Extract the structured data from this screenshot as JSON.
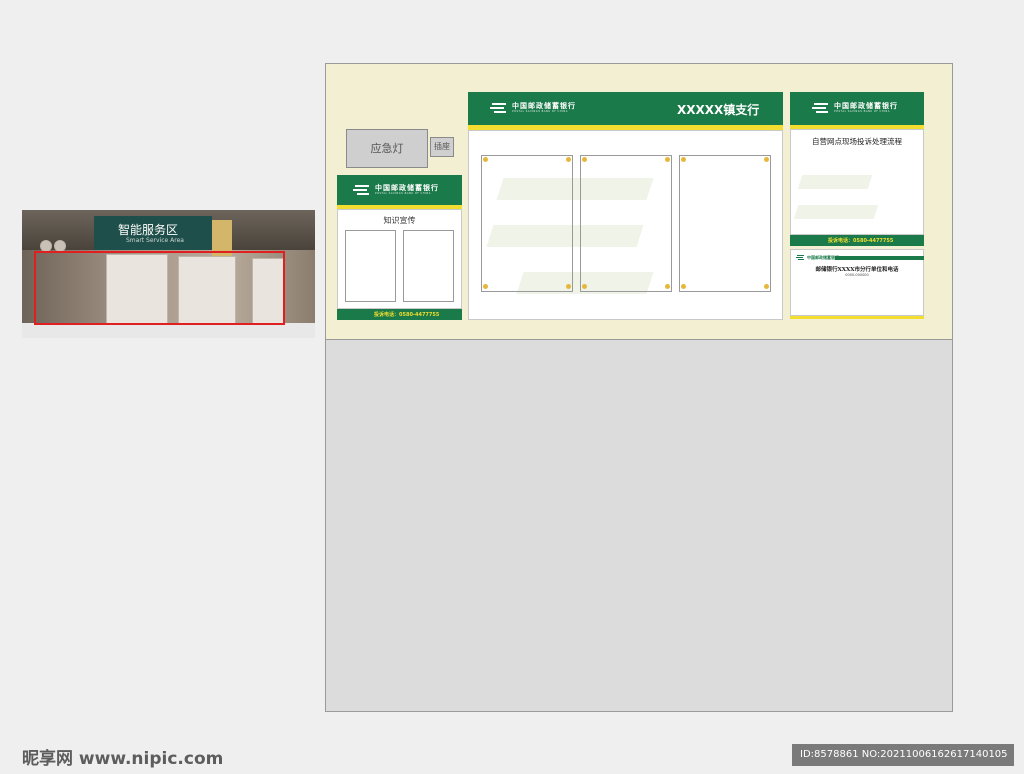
{
  "photo": {
    "sign_cn": "智能服务区",
    "sign_en": "Smart Service Area"
  },
  "board": {
    "emergency_light": "应急灯",
    "socket": "插座",
    "bank_logo_cn": "中国邮政储蓄银行",
    "bank_logo_en": "POSTAL SAVINGS BANK OF CHINA",
    "branch_name": "XXXXX镇支行",
    "left_panel": {
      "title": "知识宣传",
      "hotline": "投诉电话：0580-4477755"
    },
    "right_panel": {
      "title": "自营网点现场投诉处理流程",
      "hotline": "投诉电话：0580-4477755",
      "sub_title": "邮储银行XXXX市分行单位和电话",
      "sub_number": "0000-000000"
    }
  },
  "watermark": {
    "left": "昵享网 www.nipic.com",
    "right": "ID:8578861 NO:20211006162617140105"
  }
}
